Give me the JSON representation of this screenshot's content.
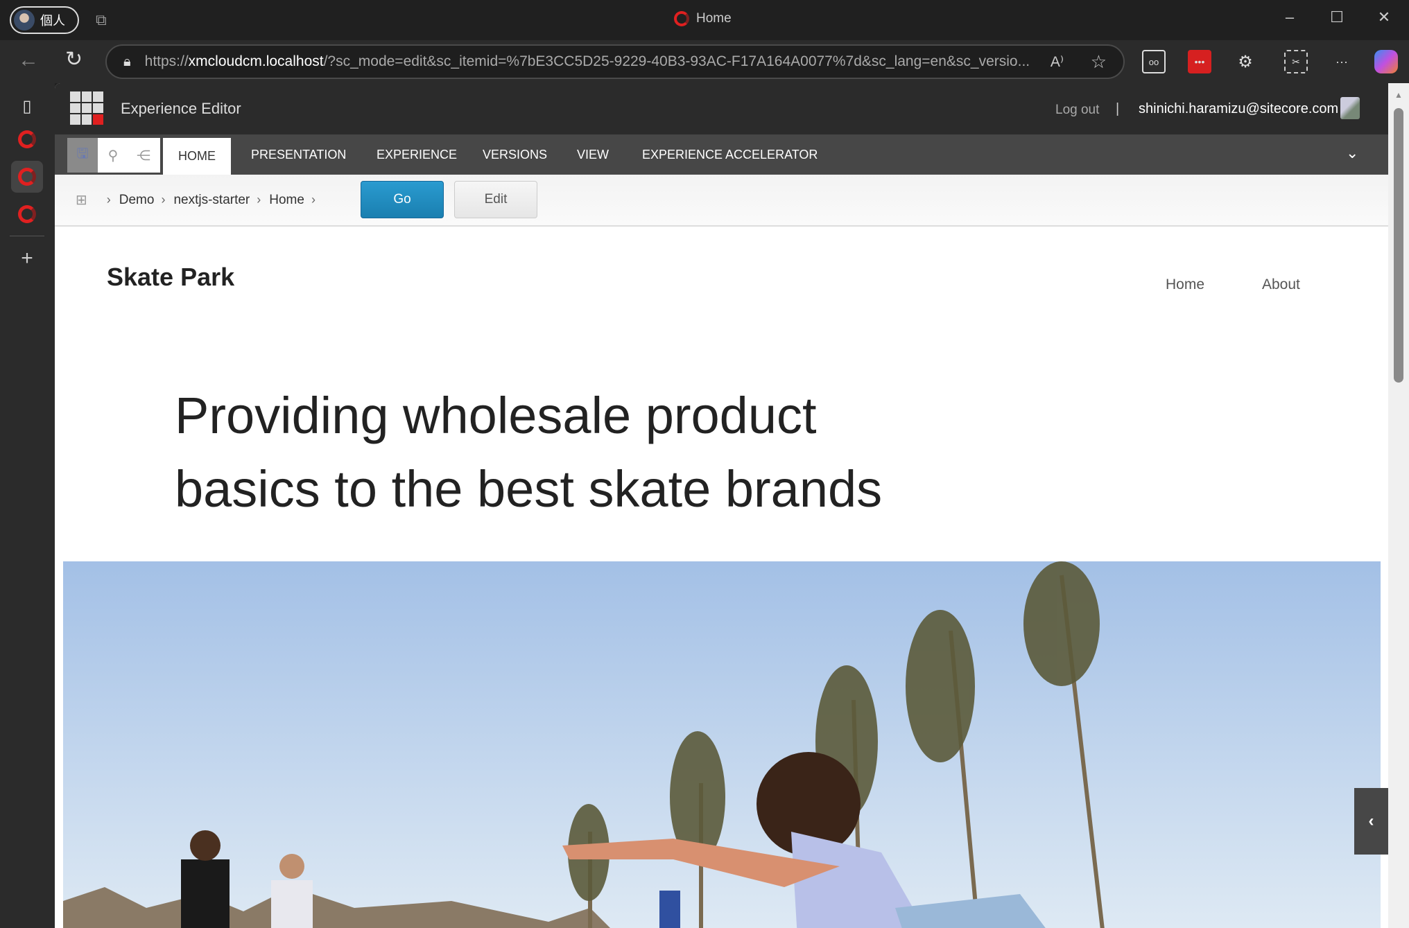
{
  "browser": {
    "profile_label": "個人",
    "window_title": "Home",
    "url_scheme": "https://",
    "url_host": "xmcloudcm.localhost",
    "url_rest": "/?sc_mode=edit&sc_itemid=%7bE3CC5D25-9229-40B3-93AC-F17A164A0077%7d&sc_lang=en&sc_versio...",
    "read_aloud": "A⁾",
    "more": "···"
  },
  "editor": {
    "app_title": "Experience Editor",
    "logout": "Log out",
    "separator": "|",
    "user": "shinichi.haramizu@sitecore.com",
    "tabs": [
      {
        "label": "HOME",
        "active": true
      },
      {
        "label": "PRESENTATION"
      },
      {
        "label": "EXPERIENCE"
      },
      {
        "label": "VERSIONS"
      },
      {
        "label": "VIEW"
      },
      {
        "label": "EXPERIENCE ACCELERATOR"
      }
    ],
    "breadcrumb": [
      "Demo",
      "nextjs-starter",
      "Home"
    ],
    "go_label": "Go",
    "edit_label": "Edit"
  },
  "site": {
    "title": "Skate Park",
    "nav": [
      "Home",
      "About"
    ],
    "headline_line1": "Providing wholesale product",
    "headline_line2": "basics to the best skate brands"
  },
  "colors": {
    "accent_red": "#e02020",
    "go_blue": "#1a8cc4"
  }
}
